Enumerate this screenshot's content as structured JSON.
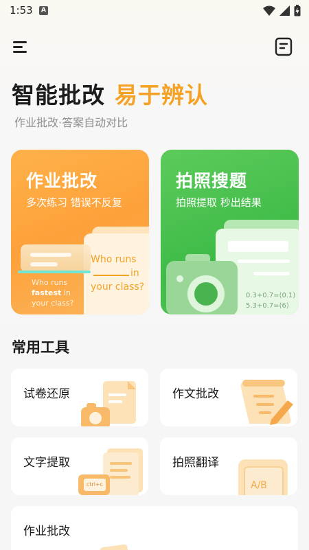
{
  "status_bar": {
    "time": "1:53",
    "notification_icon_letter": "A",
    "icons": [
      "wifi-icon",
      "signal-icon",
      "battery-icon"
    ]
  },
  "topbar": {
    "menu_icon": "menu-icon",
    "right_icon": "document-icon"
  },
  "header": {
    "title_main": "智能批改",
    "title_accent": "易于辨认",
    "subtitle": "作业批改·答案自动对比",
    "accent_color": "#f5a123"
  },
  "feature_cards": [
    {
      "title": "作业批改",
      "subtitle": "多次练习 错误不反复",
      "color": "#fda13a",
      "illustration": {
        "text_line1": "Who runs",
        "text_line2": "in",
        "text_line3": "your class?",
        "small_line1": "Who runs",
        "small_word": "fastest",
        "small_line2": "in",
        "small_line3": "your class?"
      }
    },
    {
      "title": "拍照搜题",
      "subtitle": "拍照提取 秒出结果",
      "color": "#3fbb48",
      "illustration": {
        "eq1": "0.3+0.7=",
        "ans1": "(0.1)",
        "eq2": "5.3+0.7=",
        "ans2": "(6)"
      }
    }
  ],
  "tools": {
    "section_title": "常用工具",
    "items": [
      {
        "label": "试卷还原",
        "icon": "paper-camera-icon"
      },
      {
        "label": "作文批改",
        "icon": "scroll-pen-icon"
      },
      {
        "label": "文字提取",
        "icon": "document-text-icon",
        "badge": "ctrl+c"
      },
      {
        "label": "拍照翻译",
        "icon": "translate-icon",
        "badge": "A/B"
      },
      {
        "label": "作业批改",
        "icon": "homework-icon"
      }
    ]
  }
}
